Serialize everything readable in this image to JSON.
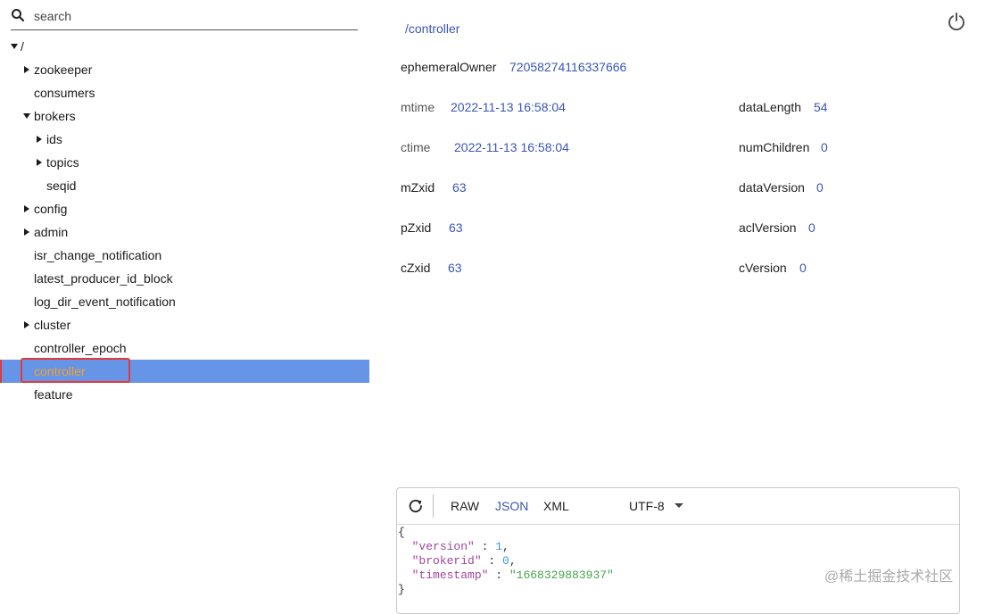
{
  "search": {
    "placeholder": "search"
  },
  "tree": [
    {
      "label": "/",
      "toggle": "expanded",
      "level": 0
    },
    {
      "label": "zookeeper",
      "toggle": "collapsed",
      "level": 1
    },
    {
      "label": "consumers",
      "toggle": "none",
      "level": 1
    },
    {
      "label": "brokers",
      "toggle": "expanded",
      "level": 1
    },
    {
      "label": "ids",
      "toggle": "collapsed",
      "level": 2
    },
    {
      "label": "topics",
      "toggle": "collapsed",
      "level": 2
    },
    {
      "label": "seqid",
      "toggle": "none",
      "level": 2
    },
    {
      "label": "config",
      "toggle": "collapsed",
      "level": 1
    },
    {
      "label": "admin",
      "toggle": "collapsed",
      "level": 1
    },
    {
      "label": "isr_change_notification",
      "toggle": "none",
      "level": 1
    },
    {
      "label": "latest_producer_id_block",
      "toggle": "none",
      "level": 1
    },
    {
      "label": "log_dir_event_notification",
      "toggle": "none",
      "level": 1
    },
    {
      "label": "cluster",
      "toggle": "collapsed",
      "level": 1
    },
    {
      "label": "controller_epoch",
      "toggle": "none",
      "level": 1
    },
    {
      "label": "controller",
      "toggle": "none",
      "level": 1,
      "selected": true
    },
    {
      "label": "feature",
      "toggle": "none",
      "level": 1
    }
  ],
  "detail": {
    "path": "/controller",
    "ephemeralOwner": {
      "label": "ephemeralOwner",
      "value": "72058274116337666"
    },
    "stats_left": [
      {
        "label": "mtime",
        "value": "2022-11-13 16:58:04"
      },
      {
        "label": "ctime",
        "value": "2022-11-13 16:58:04"
      },
      {
        "label": "mZxid",
        "value": "63"
      },
      {
        "label": "pZxid",
        "value": "63"
      },
      {
        "label": "cZxid",
        "value": "63"
      }
    ],
    "stats_right": [
      {
        "label": "dataLength",
        "value": "54"
      },
      {
        "label": "numChildren",
        "value": "0"
      },
      {
        "label": "dataVersion",
        "value": "0"
      },
      {
        "label": "aclVersion",
        "value": "0"
      },
      {
        "label": "cVersion",
        "value": "0"
      }
    ]
  },
  "viewer": {
    "formats": [
      "RAW",
      "JSON",
      "XML"
    ],
    "active_format": "JSON",
    "encoding": "UTF-8",
    "content": {
      "open": "{",
      "lines": [
        {
          "key": "\"version\"",
          "sep": " : ",
          "value": "1",
          "type": "number",
          "trail": ","
        },
        {
          "key": "\"brokerid\"",
          "sep": " : ",
          "value": "0",
          "type": "number",
          "trail": ","
        },
        {
          "key": "\"timestamp\"",
          "sep": " : ",
          "value": "\"1668329883937\"",
          "type": "string",
          "trail": ""
        }
      ],
      "close": "}"
    }
  },
  "watermark": "@稀土掘金技术社区",
  "colors": {
    "accent": "#3a56b3",
    "selection": "#6694e6",
    "selected_text": "#f2a32c",
    "highlight_box": "#e23a3a"
  }
}
